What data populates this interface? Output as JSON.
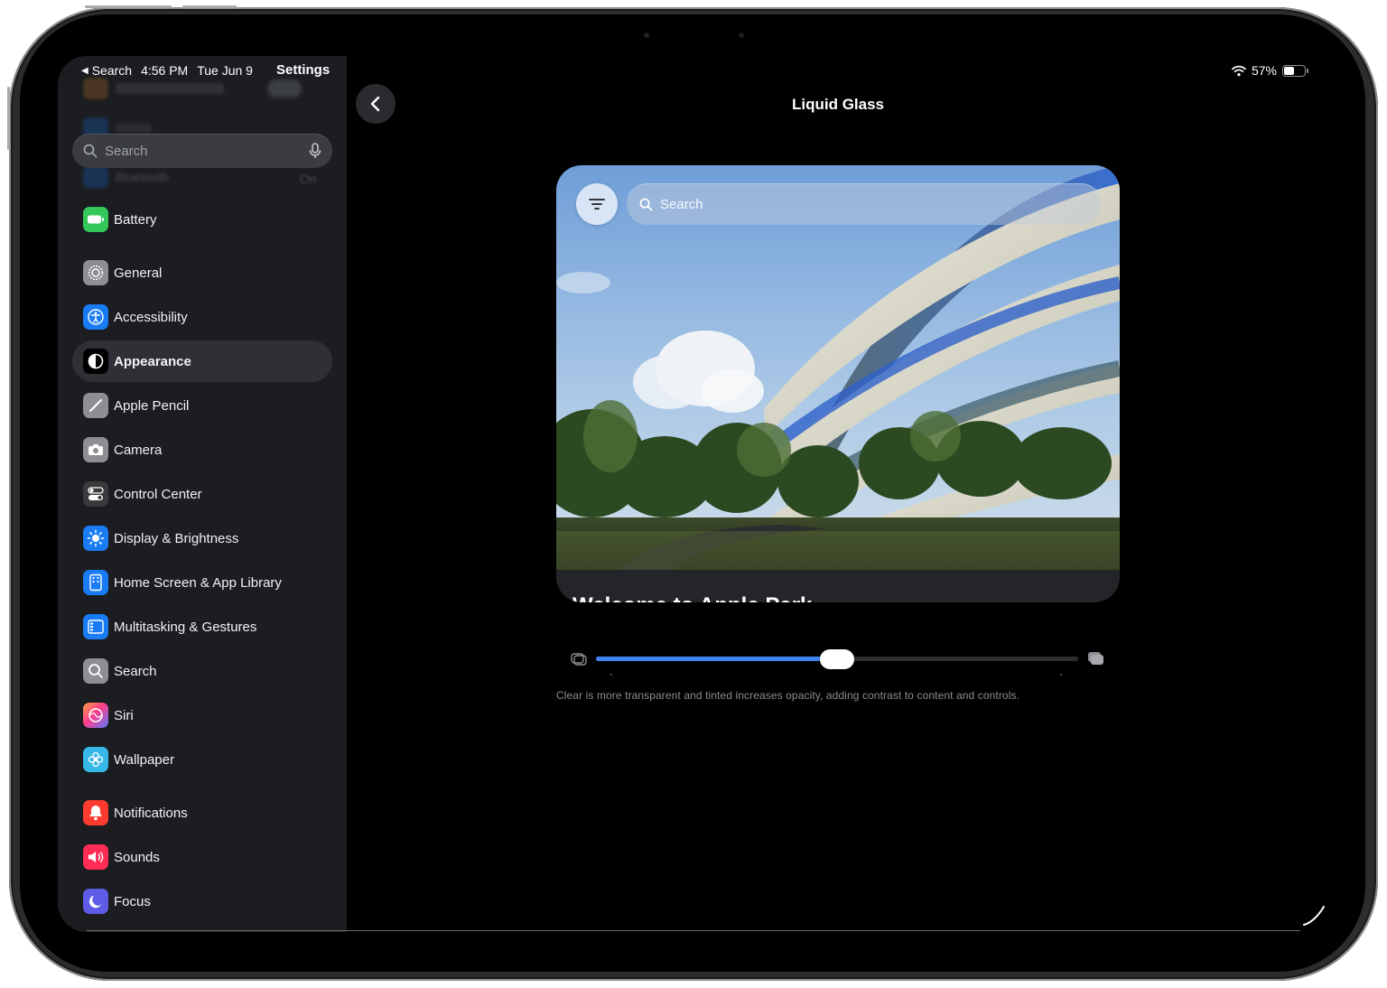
{
  "status_bar": {
    "back_app": "Search",
    "time": "4:56 PM",
    "date": "Tue Jun 9",
    "battery_percent": "57%",
    "battery_level": 0.57
  },
  "sidebar": {
    "title": "Settings",
    "search_placeholder": "Search",
    "scrolled_under": [
      {
        "label": "Bluetooth",
        "value": "On"
      }
    ],
    "items": [
      {
        "label": "Battery",
        "icon": "battery-icon",
        "color": "#34c759"
      },
      {
        "label": "General",
        "icon": "gear-icon",
        "color": "#8e8e93"
      },
      {
        "label": "Accessibility",
        "icon": "accessibility-icon",
        "color": "#1a7cf5"
      },
      {
        "label": "Appearance",
        "icon": "appearance-icon",
        "color": "#000000"
      },
      {
        "label": "Apple Pencil",
        "icon": "pencil-icon",
        "color": "#8e8e93"
      },
      {
        "label": "Camera",
        "icon": "camera-icon",
        "color": "#8e8e93"
      },
      {
        "label": "Control Center",
        "icon": "toggles-icon",
        "color": "#3a3a3c"
      },
      {
        "label": "Display & Brightness",
        "icon": "sun-icon",
        "color": "#1a7cf5"
      },
      {
        "label": "Home Screen & App Library",
        "icon": "home-screen-icon",
        "color": "#1a7cf5"
      },
      {
        "label": "Multitasking & Gestures",
        "icon": "multitasking-icon",
        "color": "#1a7cf5"
      },
      {
        "label": "Search",
        "icon": "search-icon",
        "color": "#8e8e93"
      },
      {
        "label": "Siri",
        "icon": "siri-icon",
        "color": "#ff5aa0"
      },
      {
        "label": "Wallpaper",
        "icon": "flower-icon",
        "color": "#36b8e8"
      },
      {
        "label": "Notifications",
        "icon": "bell-icon",
        "color": "#ff3b30"
      },
      {
        "label": "Sounds",
        "icon": "speaker-icon",
        "color": "#ff2d55"
      },
      {
        "label": "Focus",
        "icon": "moon-icon",
        "color": "#5e5ce6"
      }
    ],
    "selected": "Appearance"
  },
  "detail": {
    "title": "Liquid Glass",
    "preview": {
      "search_placeholder": "Search",
      "caption": "Welcome to Apple Park"
    },
    "slider": {
      "value": 0.5,
      "left_icon": "clear-glass-icon",
      "right_icon": "tinted-glass-icon",
      "accent": "#3d84f0"
    },
    "help_text": "Clear is more transparent and tinted increases opacity, adding contrast to content and controls."
  }
}
